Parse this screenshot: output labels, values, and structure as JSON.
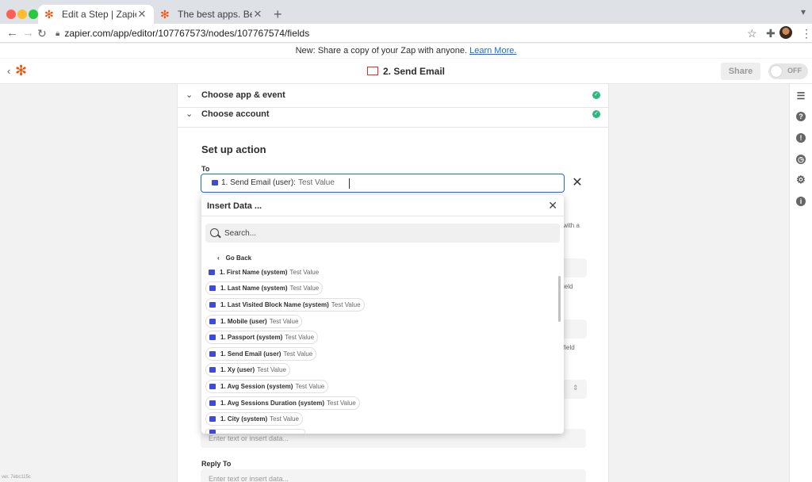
{
  "browser": {
    "tabs": [
      {
        "title": "Edit a Step | Zapier",
        "active": true
      },
      {
        "title": "The best apps. Better together",
        "active": false
      }
    ],
    "url": "zapier.com/app/editor/107767573/nodes/107767574/fields"
  },
  "banner": {
    "text": "New: Share a copy of your Zap with anyone.",
    "link": "Learn More."
  },
  "header": {
    "step_title": "2. Send Email",
    "share_label": "Share",
    "toggle_label": "OFF"
  },
  "sections": [
    {
      "label": "Choose app & event"
    },
    {
      "label": "Choose account"
    }
  ],
  "setup": {
    "title": "Set up action",
    "to_label": "To",
    "to_value": {
      "name": "1. Send Email (user):",
      "test": "Test Value"
    },
    "side_hints": [
      "with a",
      "ield",
      "field"
    ],
    "reply_to_label": "Reply To",
    "placeholder": "Enter text or insert data..."
  },
  "insert_data": {
    "title": "Insert Data ...",
    "search_placeholder": "Search...",
    "go_back": "Go Back",
    "items": [
      {
        "name": "1. First Name (system)",
        "test": "Test Value"
      },
      {
        "name": "1. Last Name (system)",
        "test": "Test Value"
      },
      {
        "name": "1. Last Visited Block Name (system)",
        "test": "Test Value"
      },
      {
        "name": "1. Mobile (user)",
        "test": "Test Value"
      },
      {
        "name": "1. Passport (system)",
        "test": "Test Value"
      },
      {
        "name": "1. Send Email (user)",
        "test": "Test Value"
      },
      {
        "name": "1. Xy (user)",
        "test": "Test Value"
      },
      {
        "name": "1. Avg Session (system)",
        "test": "Test Value"
      },
      {
        "name": "1. Avg Sessions Duration (system)",
        "test": "Test Value"
      },
      {
        "name": "1. City (system)",
        "test": "Test Value"
      }
    ]
  },
  "version": "ver. 7ebc115c"
}
